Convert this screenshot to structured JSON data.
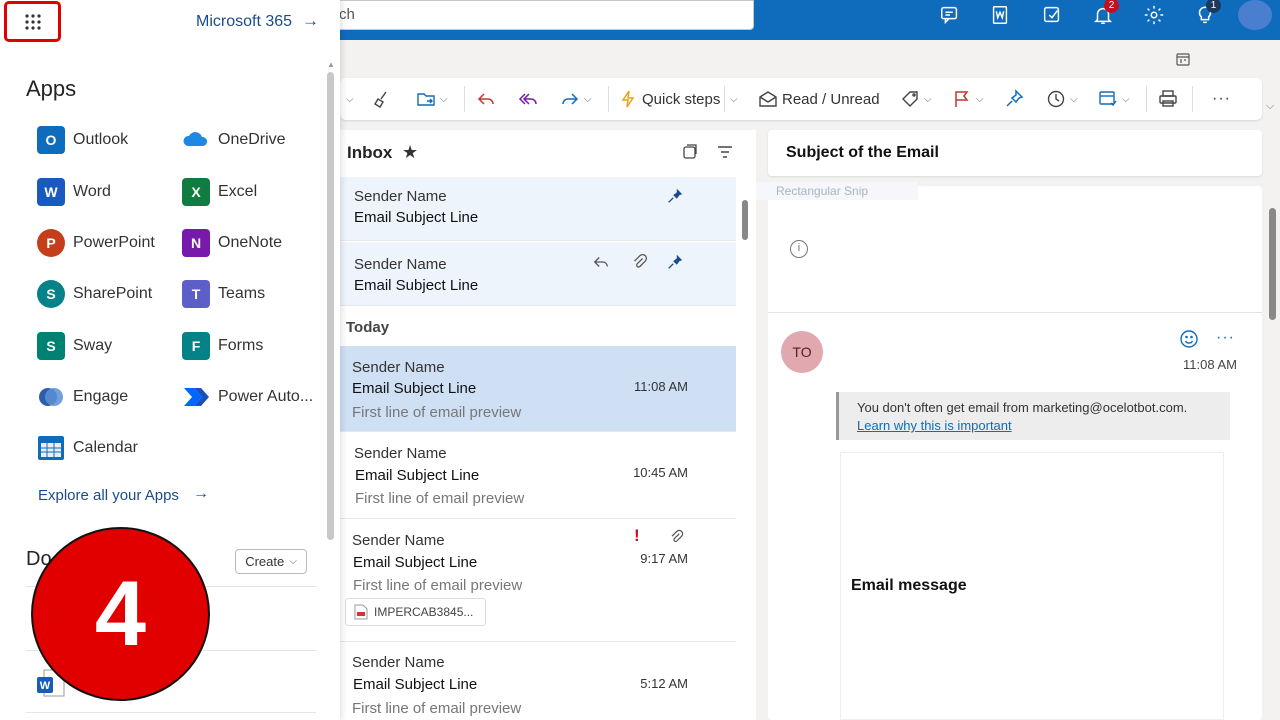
{
  "search": {
    "fragment": "ch"
  },
  "topbar": {
    "notifications_badge": "2",
    "tips_badge": "1"
  },
  "ribbon": {
    "quick_steps": "Quick steps",
    "read_unread": "Read / Unread"
  },
  "launcher": {
    "m365_link": "Microsoft 365",
    "m365_arrow": "→",
    "apps_title": "Apps",
    "apps": [
      {
        "label": "Outlook",
        "letter": "O",
        "color": "#0f6cbd"
      },
      {
        "label": "OneDrive",
        "letter": "",
        "color": "#1e88e5"
      },
      {
        "label": "Word",
        "letter": "W",
        "color": "#185abd"
      },
      {
        "label": "Excel",
        "letter": "X",
        "color": "#107c41"
      },
      {
        "label": "PowerPoint",
        "letter": "P",
        "color": "#c43e1c"
      },
      {
        "label": "OneNote",
        "letter": "N",
        "color": "#7719aa"
      },
      {
        "label": "SharePoint",
        "letter": "S",
        "color": "#038387"
      },
      {
        "label": "Teams",
        "letter": "T",
        "color": "#5b5fc7"
      },
      {
        "label": "Sway",
        "letter": "S",
        "color": "#008272"
      },
      {
        "label": "Forms",
        "letter": "F",
        "color": "#038387"
      },
      {
        "label": "Engage",
        "letter": "",
        "color": "#2e5ea8"
      },
      {
        "label": "Power Auto...",
        "letter": "",
        "color": "#0066ff"
      },
      {
        "label": "Calendar",
        "letter": "",
        "color": "#0f6cbd"
      }
    ],
    "explore": "Explore all your Apps",
    "explore_arrow": "→",
    "docs_title": "Do",
    "create": "Create",
    "step_number": "4"
  },
  "inbox": {
    "title": "Inbox",
    "today": "Today",
    "messages": [
      {
        "sender": "Sender Name",
        "subject": "Email Subject Line",
        "preview": "",
        "time": ""
      },
      {
        "sender": "Sender Name",
        "subject": "Email Subject Line",
        "preview": "",
        "time": ""
      },
      {
        "sender": "Sender Name",
        "subject": "Email Subject Line",
        "preview": "First line of email preview",
        "time": "11:08 AM"
      },
      {
        "sender": "Sender Name",
        "subject": "Email Subject Line",
        "preview": "First line of email preview",
        "time": "10:45 AM"
      },
      {
        "sender": "Sender Name",
        "subject": "Email Subject Line",
        "preview": "First line of email preview",
        "time": "9:17 AM",
        "attachment": "IMPERCAB3845..."
      },
      {
        "sender": "Sender Name",
        "subject": "Email Subject Line",
        "preview": "First line of email preview",
        "time": "5:12 AM"
      }
    ]
  },
  "reading": {
    "subject": "Subject of the Email",
    "snip_label": "Rectangular Snip",
    "info": "i",
    "avatar_initials": "TO",
    "time": "11:08 AM",
    "more": "···",
    "warning_text": "You don't often get email from marketing@ocelotbot.com.",
    "warning_link": "Learn why this is important",
    "body": "Email message"
  }
}
